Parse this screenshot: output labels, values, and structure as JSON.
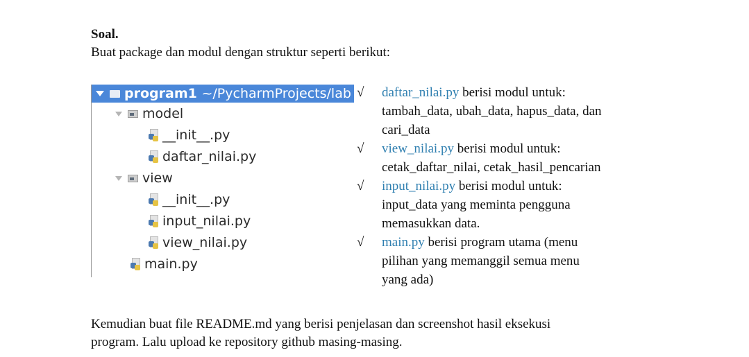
{
  "title": "Soal.",
  "intro": "Buat package dan modul dengan struktur seperti berikut:",
  "tree": {
    "root_name": "program1",
    "root_path": "~/PycharmProjects/lab",
    "model_folder": "model",
    "model_files": [
      "__init__.py",
      "daftar_nilai.py"
    ],
    "view_folder": "view",
    "view_files": [
      "__init__.py",
      "input_nilai.py",
      "view_nilai.py"
    ],
    "main_file": "main.py"
  },
  "bullets": [
    {
      "check": "√",
      "file": "daftar_nilai.py",
      "text": " berisi modul untuk:",
      "lines": [
        "tambah_data, ubah_data, hapus_data, dan",
        "cari_data"
      ]
    },
    {
      "check": "√",
      "file": "view_nilai.py",
      "text": " berisi modul untuk:",
      "lines": [
        "cetak_daftar_nilai, cetak_hasil_pencarian"
      ]
    },
    {
      "check": "√",
      "file": "input_nilai.py",
      "text": " berisi modul untuk:",
      "lines": [
        "input_data yang meminta pengguna",
        "memasukkan data."
      ]
    },
    {
      "check": "√",
      "file": "main.py",
      "text": " berisi program utama (menu",
      "lines": [
        "pilihan yang memanggil semua menu",
        "yang ada)"
      ]
    }
  ],
  "closing": {
    "line1": "Kemudian buat file README.md yang berisi penjelasan dan screenshot hasil eksekusi",
    "line2": "program. Lalu upload ke repository github masing-masing."
  },
  "colors": {
    "tree_highlight": "#4a87d9",
    "file_link": "#2f7fb0"
  }
}
